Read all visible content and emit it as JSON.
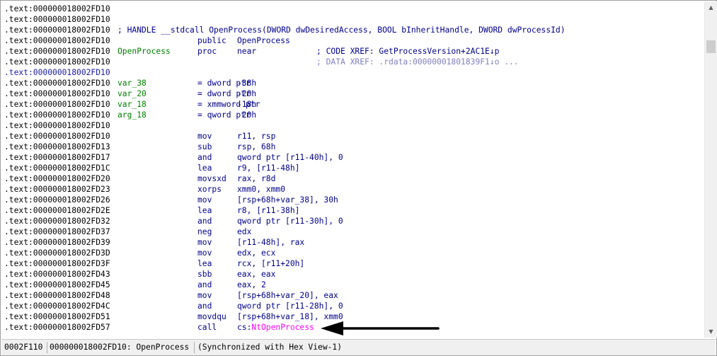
{
  "listing": {
    "lines": [
      {
        "addr": ".text:000000018002FD10",
        "blue": false,
        "label": "",
        "mnem": "",
        "ops": "",
        "comment": ""
      },
      {
        "addr": ".text:000000018002FD10",
        "blue": false,
        "label": "",
        "mnem": "",
        "ops": "",
        "comment": ""
      },
      {
        "addr": ".text:000000018002FD10",
        "blue": false,
        "label": "",
        "mnem": "",
        "ops": "",
        "comment": "; HANDLE __stdcall OpenProcess(DWORD dwDesiredAccess, BOOL bInheritHandle, DWORD dwProcessId)"
      },
      {
        "addr": ".text:000000018002FD10",
        "blue": false,
        "label": "",
        "mnem": "public",
        "ops": "OpenProcess",
        "comment": ""
      },
      {
        "addr": ".text:000000018002FD10",
        "blue": false,
        "label": "OpenProcess",
        "mnem": "proc",
        "ops": "near",
        "comment": "; CODE XREF: GetProcessVersion+2AC1E↓p"
      },
      {
        "addr": ".text:000000018002FD10",
        "blue": false,
        "label": "",
        "mnem": "",
        "ops": "",
        "comment": "; DATA XREF: .rdata:00000001801839F1↓o ..."
      },
      {
        "addr": ".text:000000018002FD10",
        "blue": true,
        "label": "",
        "mnem": "",
        "ops": "",
        "comment": ""
      },
      {
        "addr": ".text:000000018002FD10",
        "blue": false,
        "label": "var_38",
        "mnem": "= dword ptr",
        "ops": "-38h",
        "comment": ""
      },
      {
        "addr": ".text:000000018002FD10",
        "blue": false,
        "label": "var_20",
        "mnem": "= dword ptr",
        "ops": "-20h",
        "comment": ""
      },
      {
        "addr": ".text:000000018002FD10",
        "blue": false,
        "label": "var_18",
        "mnem": "= xmmword ptr",
        "ops": "-18h",
        "comment": ""
      },
      {
        "addr": ".text:000000018002FD10",
        "blue": false,
        "label": "arg_18",
        "mnem": "= qword ptr",
        "ops": " 20h",
        "comment": ""
      },
      {
        "addr": ".text:000000018002FD10",
        "blue": false,
        "label": "",
        "mnem": "",
        "ops": "",
        "comment": ""
      },
      {
        "addr": ".text:000000018002FD10",
        "blue": false,
        "label": "",
        "mnem": "mov",
        "ops": "r11, rsp",
        "comment": ""
      },
      {
        "addr": ".text:000000018002FD13",
        "blue": false,
        "label": "",
        "mnem": "sub",
        "ops": "rsp, 68h",
        "comment": ""
      },
      {
        "addr": ".text:000000018002FD17",
        "blue": false,
        "label": "",
        "mnem": "and",
        "ops": "qword ptr [r11-40h], 0",
        "comment": ""
      },
      {
        "addr": ".text:000000018002FD1C",
        "blue": false,
        "label": "",
        "mnem": "lea",
        "ops": "r9, [r11-48h]",
        "comment": ""
      },
      {
        "addr": ".text:000000018002FD20",
        "blue": false,
        "label": "",
        "mnem": "movsxd",
        "ops": "rax, r8d",
        "comment": ""
      },
      {
        "addr": ".text:000000018002FD23",
        "blue": false,
        "label": "",
        "mnem": "xorps",
        "ops": "xmm0, xmm0",
        "comment": ""
      },
      {
        "addr": ".text:000000018002FD26",
        "blue": false,
        "label": "",
        "mnem": "mov",
        "ops": "[rsp+68h+var_38], 30h",
        "comment": ""
      },
      {
        "addr": ".text:000000018002FD2E",
        "blue": false,
        "label": "",
        "mnem": "lea",
        "ops": "r8, [r11-38h]",
        "comment": ""
      },
      {
        "addr": ".text:000000018002FD32",
        "blue": false,
        "label": "",
        "mnem": "and",
        "ops": "qword ptr [r11-30h], 0",
        "comment": ""
      },
      {
        "addr": ".text:000000018002FD37",
        "blue": false,
        "label": "",
        "mnem": "neg",
        "ops": "edx",
        "comment": ""
      },
      {
        "addr": ".text:000000018002FD39",
        "blue": false,
        "label": "",
        "mnem": "mov",
        "ops": "[r11-48h], rax",
        "comment": ""
      },
      {
        "addr": ".text:000000018002FD3D",
        "blue": false,
        "label": "",
        "mnem": "mov",
        "ops": "edx, ecx",
        "comment": ""
      },
      {
        "addr": ".text:000000018002FD3F",
        "blue": false,
        "label": "",
        "mnem": "lea",
        "ops": "rcx, [r11+20h]",
        "comment": ""
      },
      {
        "addr": ".text:000000018002FD43",
        "blue": false,
        "label": "",
        "mnem": "sbb",
        "ops": "eax, eax",
        "comment": ""
      },
      {
        "addr": ".text:000000018002FD45",
        "blue": false,
        "label": "",
        "mnem": "and",
        "ops": "eax, 2",
        "comment": ""
      },
      {
        "addr": ".text:000000018002FD48",
        "blue": false,
        "label": "",
        "mnem": "mov",
        "ops": "[rsp+68h+var_20], eax",
        "comment": ""
      },
      {
        "addr": ".text:000000018002FD4C",
        "blue": false,
        "label": "",
        "mnem": "and",
        "ops": "qword ptr [r11-28h], 0",
        "comment": ""
      },
      {
        "addr": ".text:000000018002FD51",
        "blue": false,
        "label": "",
        "mnem": "movdqu",
        "ops": "[rsp+68h+var_18], xmm0",
        "comment": ""
      },
      {
        "addr": ".text:000000018002FD57",
        "blue": false,
        "label": "",
        "mnem": "call",
        "ops": "cs:",
        "ext": "NtOpenProcess",
        "comment": ""
      }
    ]
  },
  "scrollbar": {
    "up_icon": "▲",
    "down_icon": "▼"
  },
  "status": {
    "offset": "0002F110",
    "location": "000000018002FD10: OpenProcess",
    "sync": "(Synchronized with Hex View-1)"
  },
  "colors": {
    "address": "#000000",
    "label": "#008000",
    "instruction": "#00008b",
    "external": "#ff00ff",
    "arrow": "#000000"
  }
}
